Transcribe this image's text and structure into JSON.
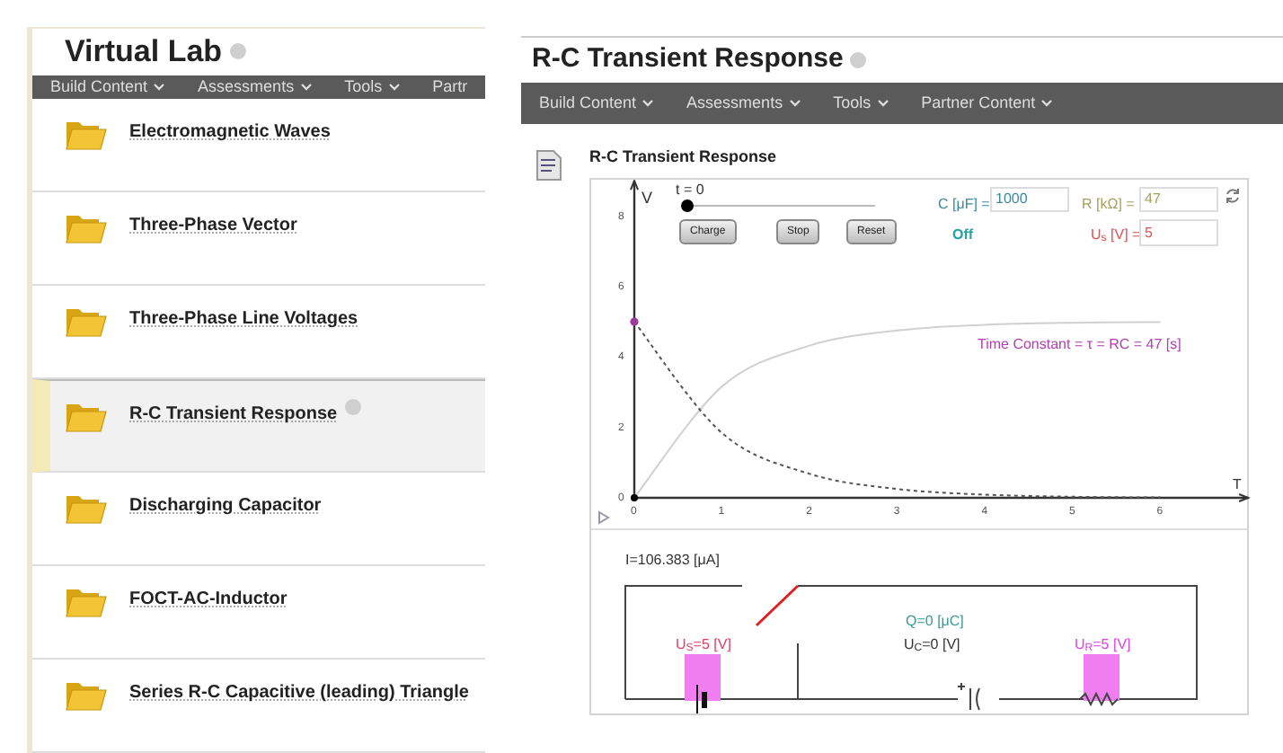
{
  "left_panel": {
    "title": "Virtual Lab",
    "menu": [
      {
        "label": "Build Content",
        "caret": true
      },
      {
        "label": "Assessments",
        "caret": true
      },
      {
        "label": "Tools",
        "caret": true
      },
      {
        "label": "Partr",
        "caret": false
      }
    ],
    "items": [
      {
        "title": "Electromagnetic Waves",
        "selected": false
      },
      {
        "title": "Three-Phase Vector",
        "selected": false
      },
      {
        "title": "Three-Phase Line Voltages",
        "selected": false
      },
      {
        "title": "R-C Transient Response",
        "selected": true
      },
      {
        "title": "Discharging Capacitor",
        "selected": false
      },
      {
        "title": "FOCT-AC-Inductor",
        "selected": false
      },
      {
        "title": "Series R-C Capacitive (leading) Triangle",
        "selected": false
      }
    ]
  },
  "right_panel": {
    "title": "R-C Transient Response",
    "menu": [
      {
        "label": "Build Content",
        "caret": true
      },
      {
        "label": "Assessments",
        "caret": true
      },
      {
        "label": "Tools",
        "caret": true
      },
      {
        "label": "Partner Content",
        "caret": true
      }
    ],
    "item_title": "R-C Transient Response",
    "applet": {
      "time_label": "t = 0",
      "time_slider": {
        "level": 0
      },
      "buttons": [
        "Charge",
        "Stop",
        "Reset"
      ],
      "capacitance": {
        "label": "C [μF] =",
        "value": "1000"
      },
      "resistance": {
        "label": "R [kΩ] =",
        "value": "47"
      },
      "switch_state": "Off",
      "switch_closed": false,
      "source_voltage": {
        "label": "U$_{s}$ [V] =",
        "value": "5"
      },
      "time_constant": "Time Constant = τ = RC = 47 [s]",
      "chart_data": {
        "type": "line",
        "xlabel": "T",
        "ylabel": "V",
        "x": [
          0,
          1,
          2,
          3,
          4,
          5,
          6
        ],
        "series": [
          {
            "color": "#d0d0d0",
            "line_style": "solid",
            "values": [
              0,
              3.16,
              4.32,
              4.75,
              4.91,
              4.97,
              4.99
            ]
          },
          {
            "color": "#555555",
            "line_style": "dashed",
            "values": [
              5,
              1.84,
              0.68,
              0.25,
              0.09,
              0.03,
              0.01
            ]
          }
        ],
        "xlim": [
          0,
          7
        ],
        "ylim": [
          0,
          9
        ],
        "xticks": [
          0,
          1,
          2,
          3,
          4,
          5,
          6
        ],
        "yticks": [
          0,
          2,
          4,
          6,
          8
        ]
      },
      "current": "I=106.383 [μA]",
      "charge": "Q=0 [μC]",
      "capacitor_voltage": "U$_{C}$=0 [V]",
      "source_label": "U$_{S}$=5 [V]",
      "resistor_label": "U$_{R}$=5 [V]"
    }
  }
}
